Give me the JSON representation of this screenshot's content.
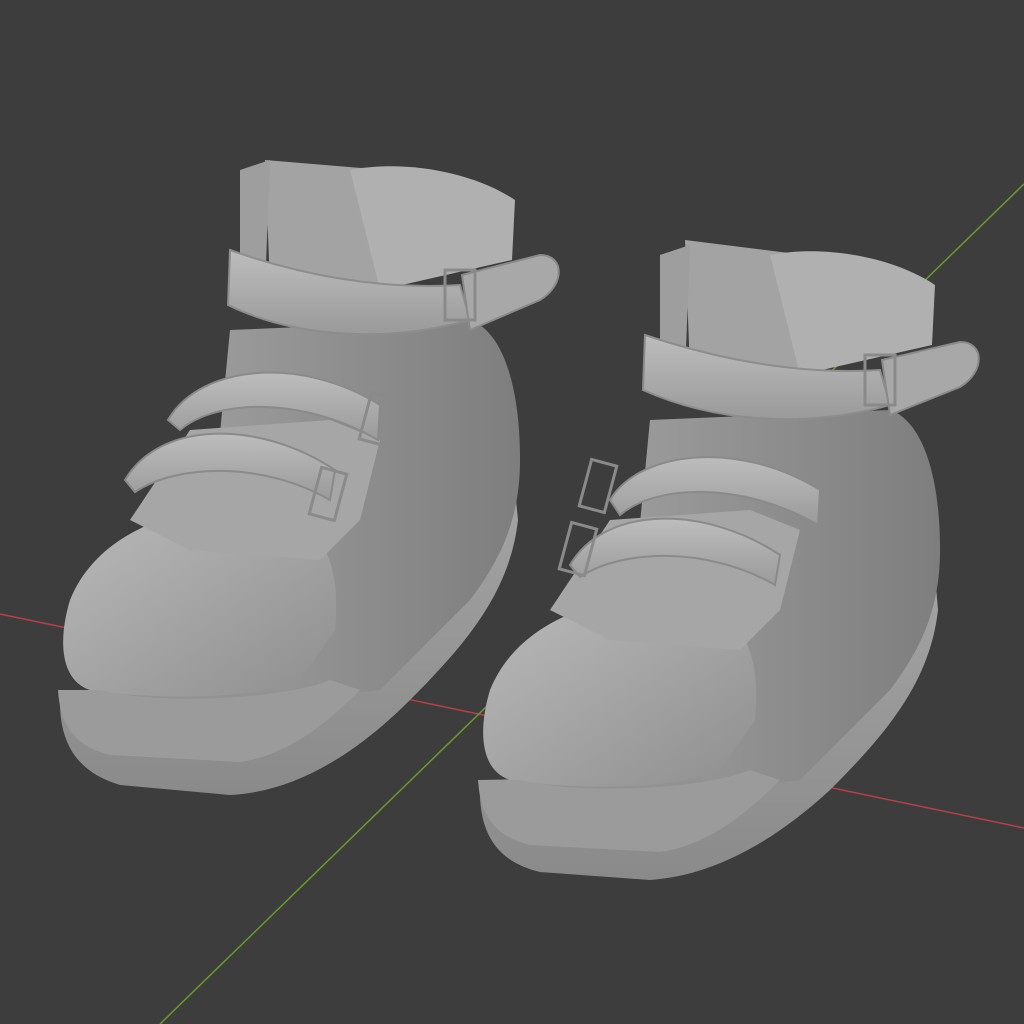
{
  "viewport": {
    "background": "#3d3d3d",
    "axis_x_color": "#b8404a",
    "axis_y_color": "#6a9a2a",
    "model_color": "#a9a9a9",
    "shadow_color": "#6f6f6f",
    "highlight_color": "#c7c7c7"
  },
  "scene": {
    "objects": [
      {
        "name": "left-shoe",
        "icon": "sneaker-mesh"
      },
      {
        "name": "right-shoe",
        "icon": "sneaker-mesh"
      }
    ]
  }
}
